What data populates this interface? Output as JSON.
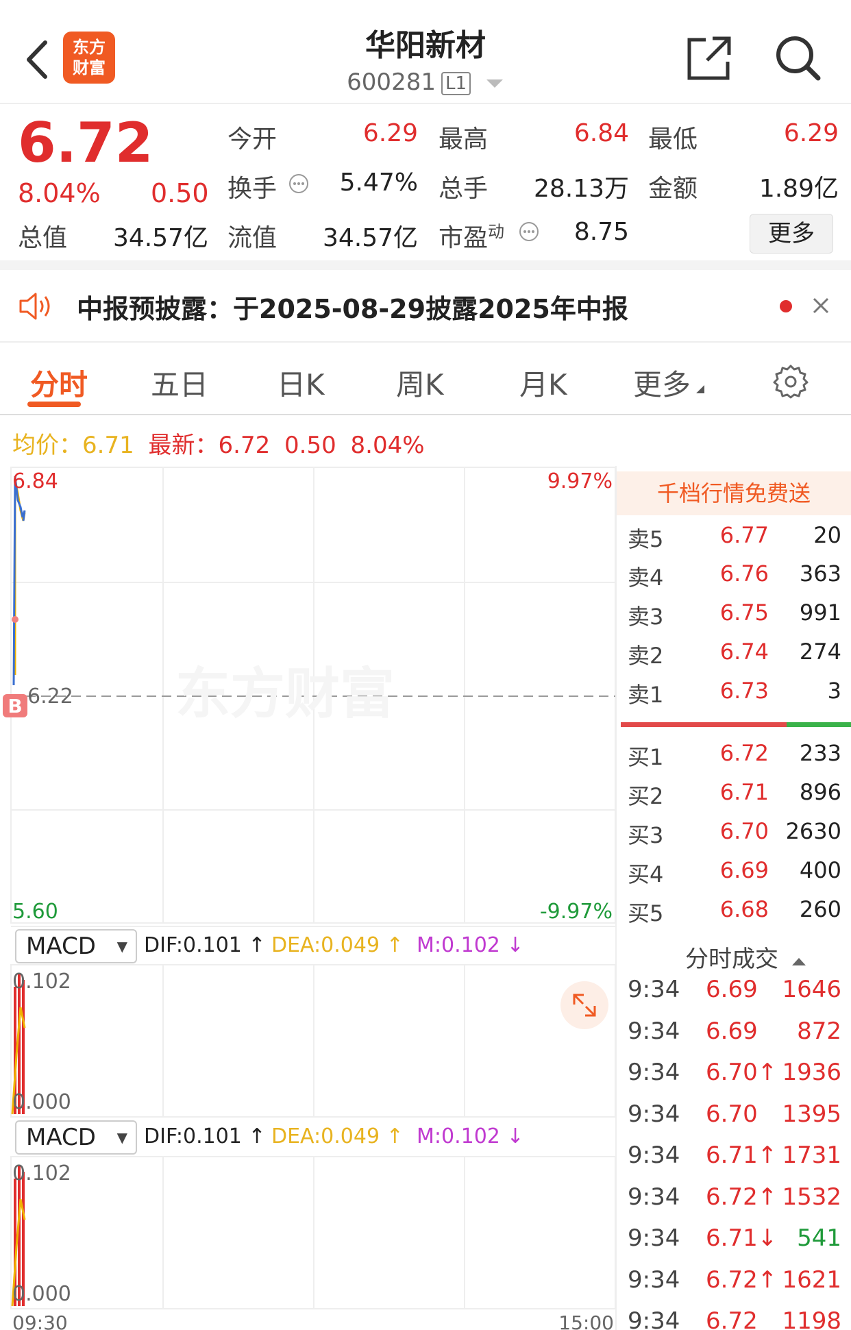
{
  "header": {
    "stock_name": "华阳新材",
    "stock_code": "600281",
    "level": "L1",
    "logo_line1": "东方",
    "logo_line2": "财富"
  },
  "quote": {
    "price": "6.72",
    "change_pct": "8.04%",
    "change": "0.50",
    "open_label": "今开",
    "open": "6.29",
    "high_label": "最高",
    "high": "6.84",
    "low_label": "最低",
    "low": "6.29",
    "turnover_label": "换手",
    "turnover": "5.47%",
    "volume_label": "总手",
    "volume": "28.13万",
    "amount_label": "金额",
    "amount": "1.89亿",
    "mktcap_label": "总值",
    "mktcap": "34.57亿",
    "float_label": "流值",
    "float_cap": "34.57亿",
    "pe_label": "市盈",
    "pe_sup": "动",
    "pe": "8.75",
    "more_label": "更多"
  },
  "notice": {
    "text": "中报预披露：于2025-08-29披露2025年中报"
  },
  "tabs": [
    "分时",
    "五日",
    "日K",
    "周K",
    "月K",
    "更多"
  ],
  "info_line": {
    "avg_label": "均价：",
    "avg": "6.71",
    "latest_label": "最新：",
    "latest": "6.72",
    "chg": "0.50",
    "pct": "8.04%"
  },
  "chart": {
    "y_top": "6.84",
    "y_mid": "6.22",
    "y_bottom": "5.60",
    "pct_top": "9.97%",
    "pct_bottom": "-9.97%",
    "x_start": "09:30",
    "x_end": "15:00",
    "watermark": "东方财富",
    "marker": "B"
  },
  "macd": [
    {
      "selector": "MACD",
      "dif": "DIF:0.101 ↑",
      "dea": "DEA:0.049 ↑",
      "m": "M:0.102 ↓",
      "top": "0.102",
      "bottom": "0.000"
    },
    {
      "selector": "MACD",
      "dif": "DIF:0.101 ↑",
      "dea": "DEA:0.049 ↑",
      "m": "M:0.102 ↓",
      "top": "0.102",
      "bottom": "0.000"
    }
  ],
  "order_book": {
    "banner": "千档行情免费送",
    "asks": [
      {
        "label": "卖5",
        "price": "6.77",
        "vol": "20"
      },
      {
        "label": "卖4",
        "price": "6.76",
        "vol": "363"
      },
      {
        "label": "卖3",
        "price": "6.75",
        "vol": "991"
      },
      {
        "label": "卖2",
        "price": "6.74",
        "vol": "274"
      },
      {
        "label": "卖1",
        "price": "6.73",
        "vol": "3"
      }
    ],
    "bids": [
      {
        "label": "买1",
        "price": "6.72",
        "vol": "233"
      },
      {
        "label": "买2",
        "price": "6.71",
        "vol": "896"
      },
      {
        "label": "买3",
        "price": "6.70",
        "vol": "2630"
      },
      {
        "label": "买4",
        "price": "6.69",
        "vol": "400"
      },
      {
        "label": "买5",
        "price": "6.68",
        "vol": "260"
      }
    ]
  },
  "trades": {
    "title": "分时成交",
    "rows": [
      {
        "time": "9:34",
        "price": "6.69",
        "vol": "1646",
        "dir": ""
      },
      {
        "time": "9:34",
        "price": "6.69",
        "vol": "872",
        "dir": ""
      },
      {
        "time": "9:34",
        "price": "6.70↑",
        "vol": "1936",
        "dir": "up"
      },
      {
        "time": "9:34",
        "price": "6.70",
        "vol": "1395",
        "dir": ""
      },
      {
        "time": "9:34",
        "price": "6.71↑",
        "vol": "1731",
        "dir": "up"
      },
      {
        "time": "9:34",
        "price": "6.72↑",
        "vol": "1532",
        "dir": "up"
      },
      {
        "time": "9:34",
        "price": "6.71↓",
        "vol": "541",
        "dir": "down"
      },
      {
        "time": "9:34",
        "price": "6.72↑",
        "vol": "1621",
        "dir": "up"
      },
      {
        "time": "9:34",
        "price": "6.72",
        "vol": "1198",
        "dir": ""
      }
    ]
  },
  "colors": {
    "up": "#e02d2d",
    "down": "#1f9a3a",
    "accent": "#f05a23",
    "avg_line": "#f0b400",
    "price_line": "#3a6fd0",
    "dea": "#e8b320",
    "m": "#c03ad0"
  },
  "icons": [
    "back-arrow-icon",
    "share-icon",
    "search-icon",
    "speaker-icon",
    "close-icon",
    "gear-icon",
    "expand-icon",
    "chevron-down-icon"
  ]
}
